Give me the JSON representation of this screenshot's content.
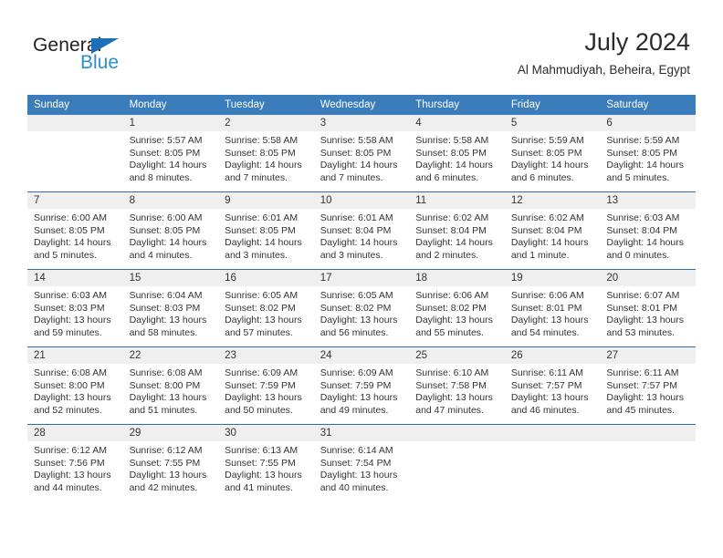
{
  "brand": {
    "name_part1": "General",
    "name_part2": "Blue",
    "accent_color": "#2b8fd4",
    "triangle_color": "#1c6fb8"
  },
  "header": {
    "month_title": "July 2024",
    "location": "Al Mahmudiyah, Beheira, Egypt"
  },
  "calendar": {
    "header_color": "#3b7cba",
    "row_line_color": "#2f6fae",
    "daynum_band_color": "#efefef",
    "weekday_headers": [
      "Sunday",
      "Monday",
      "Tuesday",
      "Wednesday",
      "Thursday",
      "Friday",
      "Saturday"
    ],
    "weeks": [
      [
        {
          "day": "",
          "sunrise": "",
          "sunset": "",
          "daylight_line1": "",
          "daylight_line2": ""
        },
        {
          "day": "1",
          "sunrise": "Sunrise: 5:57 AM",
          "sunset": "Sunset: 8:05 PM",
          "daylight_line1": "Daylight: 14 hours",
          "daylight_line2": "and 8 minutes."
        },
        {
          "day": "2",
          "sunrise": "Sunrise: 5:58 AM",
          "sunset": "Sunset: 8:05 PM",
          "daylight_line1": "Daylight: 14 hours",
          "daylight_line2": "and 7 minutes."
        },
        {
          "day": "3",
          "sunrise": "Sunrise: 5:58 AM",
          "sunset": "Sunset: 8:05 PM",
          "daylight_line1": "Daylight: 14 hours",
          "daylight_line2": "and 7 minutes."
        },
        {
          "day": "4",
          "sunrise": "Sunrise: 5:58 AM",
          "sunset": "Sunset: 8:05 PM",
          "daylight_line1": "Daylight: 14 hours",
          "daylight_line2": "and 6 minutes."
        },
        {
          "day": "5",
          "sunrise": "Sunrise: 5:59 AM",
          "sunset": "Sunset: 8:05 PM",
          "daylight_line1": "Daylight: 14 hours",
          "daylight_line2": "and 6 minutes."
        },
        {
          "day": "6",
          "sunrise": "Sunrise: 5:59 AM",
          "sunset": "Sunset: 8:05 PM",
          "daylight_line1": "Daylight: 14 hours",
          "daylight_line2": "and 5 minutes."
        }
      ],
      [
        {
          "day": "7",
          "sunrise": "Sunrise: 6:00 AM",
          "sunset": "Sunset: 8:05 PM",
          "daylight_line1": "Daylight: 14 hours",
          "daylight_line2": "and 5 minutes."
        },
        {
          "day": "8",
          "sunrise": "Sunrise: 6:00 AM",
          "sunset": "Sunset: 8:05 PM",
          "daylight_line1": "Daylight: 14 hours",
          "daylight_line2": "and 4 minutes."
        },
        {
          "day": "9",
          "sunrise": "Sunrise: 6:01 AM",
          "sunset": "Sunset: 8:05 PM",
          "daylight_line1": "Daylight: 14 hours",
          "daylight_line2": "and 3 minutes."
        },
        {
          "day": "10",
          "sunrise": "Sunrise: 6:01 AM",
          "sunset": "Sunset: 8:04 PM",
          "daylight_line1": "Daylight: 14 hours",
          "daylight_line2": "and 3 minutes."
        },
        {
          "day": "11",
          "sunrise": "Sunrise: 6:02 AM",
          "sunset": "Sunset: 8:04 PM",
          "daylight_line1": "Daylight: 14 hours",
          "daylight_line2": "and 2 minutes."
        },
        {
          "day": "12",
          "sunrise": "Sunrise: 6:02 AM",
          "sunset": "Sunset: 8:04 PM",
          "daylight_line1": "Daylight: 14 hours",
          "daylight_line2": "and 1 minute."
        },
        {
          "day": "13",
          "sunrise": "Sunrise: 6:03 AM",
          "sunset": "Sunset: 8:04 PM",
          "daylight_line1": "Daylight: 14 hours",
          "daylight_line2": "and 0 minutes."
        }
      ],
      [
        {
          "day": "14",
          "sunrise": "Sunrise: 6:03 AM",
          "sunset": "Sunset: 8:03 PM",
          "daylight_line1": "Daylight: 13 hours",
          "daylight_line2": "and 59 minutes."
        },
        {
          "day": "15",
          "sunrise": "Sunrise: 6:04 AM",
          "sunset": "Sunset: 8:03 PM",
          "daylight_line1": "Daylight: 13 hours",
          "daylight_line2": "and 58 minutes."
        },
        {
          "day": "16",
          "sunrise": "Sunrise: 6:05 AM",
          "sunset": "Sunset: 8:02 PM",
          "daylight_line1": "Daylight: 13 hours",
          "daylight_line2": "and 57 minutes."
        },
        {
          "day": "17",
          "sunrise": "Sunrise: 6:05 AM",
          "sunset": "Sunset: 8:02 PM",
          "daylight_line1": "Daylight: 13 hours",
          "daylight_line2": "and 56 minutes."
        },
        {
          "day": "18",
          "sunrise": "Sunrise: 6:06 AM",
          "sunset": "Sunset: 8:02 PM",
          "daylight_line1": "Daylight: 13 hours",
          "daylight_line2": "and 55 minutes."
        },
        {
          "day": "19",
          "sunrise": "Sunrise: 6:06 AM",
          "sunset": "Sunset: 8:01 PM",
          "daylight_line1": "Daylight: 13 hours",
          "daylight_line2": "and 54 minutes."
        },
        {
          "day": "20",
          "sunrise": "Sunrise: 6:07 AM",
          "sunset": "Sunset: 8:01 PM",
          "daylight_line1": "Daylight: 13 hours",
          "daylight_line2": "and 53 minutes."
        }
      ],
      [
        {
          "day": "21",
          "sunrise": "Sunrise: 6:08 AM",
          "sunset": "Sunset: 8:00 PM",
          "daylight_line1": "Daylight: 13 hours",
          "daylight_line2": "and 52 minutes."
        },
        {
          "day": "22",
          "sunrise": "Sunrise: 6:08 AM",
          "sunset": "Sunset: 8:00 PM",
          "daylight_line1": "Daylight: 13 hours",
          "daylight_line2": "and 51 minutes."
        },
        {
          "day": "23",
          "sunrise": "Sunrise: 6:09 AM",
          "sunset": "Sunset: 7:59 PM",
          "daylight_line1": "Daylight: 13 hours",
          "daylight_line2": "and 50 minutes."
        },
        {
          "day": "24",
          "sunrise": "Sunrise: 6:09 AM",
          "sunset": "Sunset: 7:59 PM",
          "daylight_line1": "Daylight: 13 hours",
          "daylight_line2": "and 49 minutes."
        },
        {
          "day": "25",
          "sunrise": "Sunrise: 6:10 AM",
          "sunset": "Sunset: 7:58 PM",
          "daylight_line1": "Daylight: 13 hours",
          "daylight_line2": "and 47 minutes."
        },
        {
          "day": "26",
          "sunrise": "Sunrise: 6:11 AM",
          "sunset": "Sunset: 7:57 PM",
          "daylight_line1": "Daylight: 13 hours",
          "daylight_line2": "and 46 minutes."
        },
        {
          "day": "27",
          "sunrise": "Sunrise: 6:11 AM",
          "sunset": "Sunset: 7:57 PM",
          "daylight_line1": "Daylight: 13 hours",
          "daylight_line2": "and 45 minutes."
        }
      ],
      [
        {
          "day": "28",
          "sunrise": "Sunrise: 6:12 AM",
          "sunset": "Sunset: 7:56 PM",
          "daylight_line1": "Daylight: 13 hours",
          "daylight_line2": "and 44 minutes."
        },
        {
          "day": "29",
          "sunrise": "Sunrise: 6:12 AM",
          "sunset": "Sunset: 7:55 PM",
          "daylight_line1": "Daylight: 13 hours",
          "daylight_line2": "and 42 minutes."
        },
        {
          "day": "30",
          "sunrise": "Sunrise: 6:13 AM",
          "sunset": "Sunset: 7:55 PM",
          "daylight_line1": "Daylight: 13 hours",
          "daylight_line2": "and 41 minutes."
        },
        {
          "day": "31",
          "sunrise": "Sunrise: 6:14 AM",
          "sunset": "Sunset: 7:54 PM",
          "daylight_line1": "Daylight: 13 hours",
          "daylight_line2": "and 40 minutes."
        },
        {
          "day": "",
          "sunrise": "",
          "sunset": "",
          "daylight_line1": "",
          "daylight_line2": ""
        },
        {
          "day": "",
          "sunrise": "",
          "sunset": "",
          "daylight_line1": "",
          "daylight_line2": ""
        },
        {
          "day": "",
          "sunrise": "",
          "sunset": "",
          "daylight_line1": "",
          "daylight_line2": ""
        }
      ]
    ]
  }
}
